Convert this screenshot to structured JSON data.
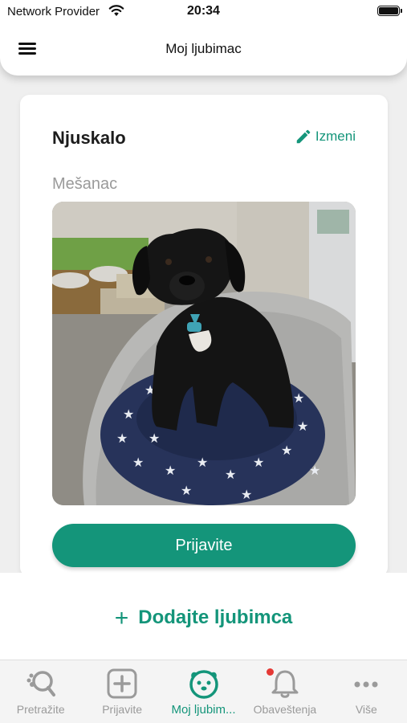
{
  "status_bar": {
    "carrier": "Network Provider",
    "time": "20:34"
  },
  "header": {
    "title": "Moj ljubimac"
  },
  "pet": {
    "name": "Njuskalo",
    "edit_label": "Izmeni",
    "breed": "Mešanac",
    "report_label": "Prijavite"
  },
  "add_pet": {
    "label": "Dodajte ljubimca"
  },
  "nav": {
    "tabs": [
      {
        "label": "Pretražite",
        "icon": "search-paw-icon",
        "active": false
      },
      {
        "label": "Prijavite",
        "icon": "plus-square-icon",
        "active": false
      },
      {
        "label": "Moj ljubim...",
        "icon": "dog-face-icon",
        "active": true
      },
      {
        "label": "Obaveštenja",
        "icon": "bell-icon",
        "active": false
      },
      {
        "label": "Više",
        "icon": "more-dots-icon",
        "active": false
      }
    ]
  },
  "colors": {
    "accent": "#14957a",
    "inactive": "#9a9a9a",
    "badge": "#e53935"
  }
}
